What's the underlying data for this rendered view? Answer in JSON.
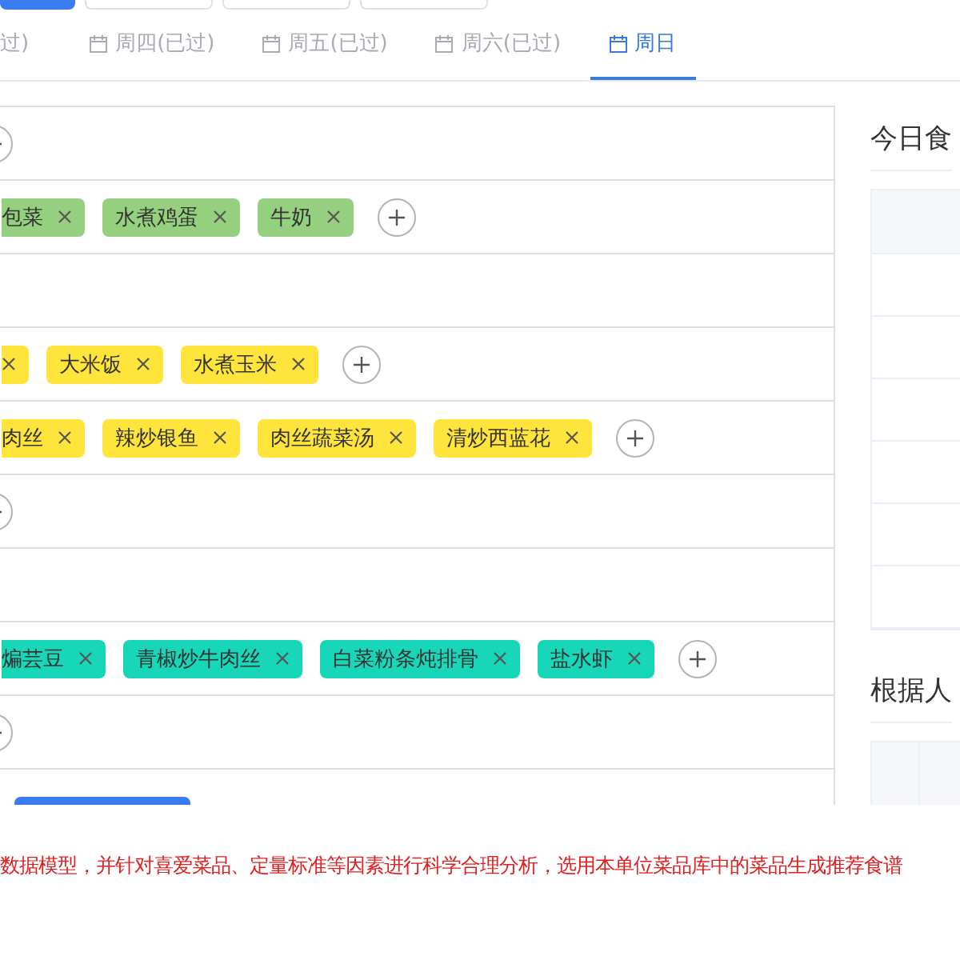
{
  "top_buttons": [
    {
      "selected": true
    },
    {
      "selected": false
    },
    {
      "selected": false
    },
    {
      "selected": false
    }
  ],
  "tabs": [
    {
      "label": "过)",
      "kind": "partial",
      "selected": false
    },
    {
      "label": "周四(已过)",
      "kind": "day",
      "selected": false
    },
    {
      "label": "周五(已过)",
      "kind": "day",
      "selected": false
    },
    {
      "label": "周六(已过)",
      "kind": "day",
      "selected": false
    },
    {
      "label": "周日",
      "kind": "day",
      "selected": true
    }
  ],
  "meal_rows": [
    {
      "kind": "add"
    },
    {
      "kind": "tags",
      "color": "#95d07f",
      "tags": [
        {
          "label": "包菜",
          "kind": "partial"
        },
        {
          "label": "水煮鸡蛋",
          "kind": "full"
        },
        {
          "label": "牛奶",
          "kind": "full"
        }
      ]
    },
    {
      "kind": "empty"
    },
    {
      "kind": "tags",
      "color": "#ffe53b",
      "tags": [
        {
          "kind": "stub"
        },
        {
          "label": "大米饭",
          "kind": "full"
        },
        {
          "label": "水煮玉米",
          "kind": "full"
        }
      ]
    },
    {
      "kind": "tags",
      "color": "#ffe53b",
      "tags": [
        {
          "label": "肉丝",
          "kind": "partial"
        },
        {
          "label": "辣炒银鱼",
          "kind": "full"
        },
        {
          "label": "肉丝蔬菜汤",
          "kind": "full"
        },
        {
          "label": "清炒西蓝花",
          "kind": "full"
        }
      ]
    },
    {
      "kind": "add"
    },
    {
      "kind": "empty"
    },
    {
      "kind": "tags",
      "color": "#18d6b8",
      "tags": [
        {
          "label": "煸芸豆",
          "kind": "partial"
        },
        {
          "label": "青椒炒牛肉丝",
          "kind": "full"
        },
        {
          "label": "白菜粉条炖排骨",
          "kind": "full"
        },
        {
          "label": "盐水虾",
          "kind": "full"
        }
      ]
    },
    {
      "kind": "add"
    },
    {
      "kind": "button"
    }
  ],
  "side": {
    "menu_title": "今日食",
    "body_title": "根据人"
  },
  "note": "数据模型，并针对喜爱菜品、定量标准等因素进行科学合理分析，选用本单位菜品库中的菜品生成推荐食谱"
}
